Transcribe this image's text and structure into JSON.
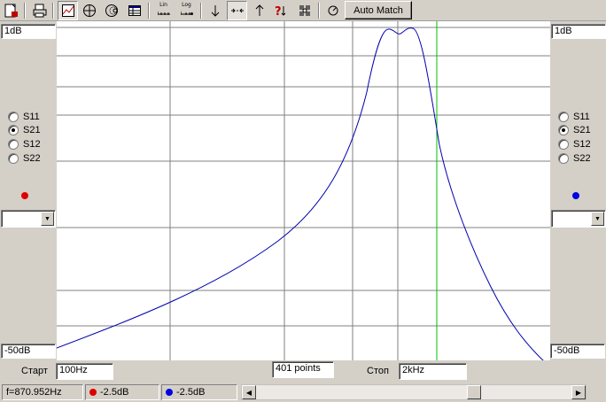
{
  "toolbar": {
    "lin_label": "Lin",
    "log_label": "Log",
    "help_label": "?",
    "auto_match_label": "Auto Match"
  },
  "left_panel": {
    "top_scale": "1dB",
    "bottom_scale": "-50dB",
    "params": [
      {
        "label": "S11",
        "selected": false
      },
      {
        "label": "S21",
        "selected": true
      },
      {
        "label": "S12",
        "selected": false
      },
      {
        "label": "S22",
        "selected": false
      }
    ],
    "marker_color": "#e00000",
    "combo_value": ""
  },
  "right_panel": {
    "top_scale": "1dB",
    "bottom_scale": "-50dB",
    "params": [
      {
        "label": "S11",
        "selected": false
      },
      {
        "label": "S21",
        "selected": true
      },
      {
        "label": "S12",
        "selected": false
      },
      {
        "label": "S22",
        "selected": false
      }
    ],
    "marker_color": "#0000e0",
    "combo_value": ""
  },
  "sweep": {
    "start_label": "Старт",
    "start_value": "100Hz",
    "points_value": "401 points",
    "stop_label": "Стоп",
    "stop_value": "2kHz"
  },
  "status": {
    "frequency": "f=870.952Hz",
    "marker1_value": "-2.5dB",
    "marker1_color": "#e00000",
    "marker2_value": "-2.5dB",
    "marker2_color": "#0000e0",
    "scroll_fraction": 0.7
  },
  "colors": {
    "trace": "#0000b0",
    "cursor": "#00c000",
    "grid": "#808080"
  }
}
